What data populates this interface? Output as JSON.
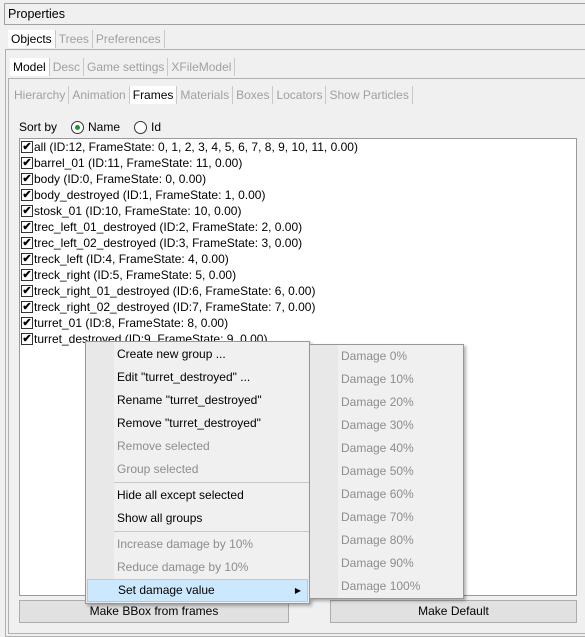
{
  "window": {
    "title": "Properties"
  },
  "tabs1": [
    {
      "label": "Objects",
      "active": true
    },
    {
      "label": "Trees"
    },
    {
      "label": "Preferences"
    }
  ],
  "tabs2": [
    {
      "label": "Model",
      "active": true
    },
    {
      "label": "Desc"
    },
    {
      "label": "Game settings"
    },
    {
      "label": "XFileModel"
    }
  ],
  "tabs3": [
    {
      "label": "Hierarchy"
    },
    {
      "label": "Animation"
    },
    {
      "label": "Frames",
      "active": true
    },
    {
      "label": "Materials"
    },
    {
      "label": "Boxes"
    },
    {
      "label": "Locators"
    },
    {
      "label": "Show Particles"
    }
  ],
  "sort": {
    "label": "Sort by",
    "options": [
      "Name",
      "Id"
    ],
    "selected": "Name"
  },
  "frames": [
    "all (ID:12, FrameState: 0, 1, 2, 3, 4, 5, 6, 7, 8, 9, 10, 11, 0.00)",
    "barrel_01 (ID:11, FrameState: 11, 0.00)",
    "body (ID:0, FrameState: 0, 0.00)",
    "body_destroyed (ID:1, FrameState: 1, 0.00)",
    "stosk_01 (ID:10, FrameState: 10, 0.00)",
    "trec_left_01_destroyed (ID:2, FrameState: 2, 0.00)",
    "trec_left_02_destroyed (ID:3, FrameState: 3, 0.00)",
    "treck_left (ID:4, FrameState: 4, 0.00)",
    "treck_right (ID:5, FrameState: 5, 0.00)",
    "treck_right_01_destroyed (ID:6, FrameState: 6, 0.00)",
    "treck_right_02_destroyed (ID:7, FrameState: 7, 0.00)",
    "turret_01 (ID:8, FrameState: 8, 0.00)",
    "turret_destroyed (ID:9, FrameState: 9, 0.00)"
  ],
  "buttons": {
    "bbox": "Make BBox from frames",
    "default": "Make Default"
  },
  "context_menu": [
    {
      "label": "Create new group ..."
    },
    {
      "label": "Edit \"turret_destroyed\" ..."
    },
    {
      "label": "Rename \"turret_destroyed\""
    },
    {
      "label": "Remove \"turret_destroyed\""
    },
    {
      "label": "Remove selected",
      "disabled": true
    },
    {
      "label": "Group selected",
      "disabled": true
    },
    {
      "separator": true
    },
    {
      "label": "Hide all except selected"
    },
    {
      "label": "Show all groups"
    },
    {
      "separator": true
    },
    {
      "label": "Increase damage by 10%",
      "disabled": true
    },
    {
      "label": "Reduce damage by 10%",
      "disabled": true
    },
    {
      "label": "Set damage value",
      "highlighted": true,
      "submenu": true
    }
  ],
  "submenu": [
    "Damage 0%",
    "Damage 10%",
    "Damage 20%",
    "Damage 30%",
    "Damage 40%",
    "Damage 50%",
    "Damage 60%",
    "Damage 70%",
    "Damage 80%",
    "Damage 90%",
    "Damage 100%"
  ]
}
